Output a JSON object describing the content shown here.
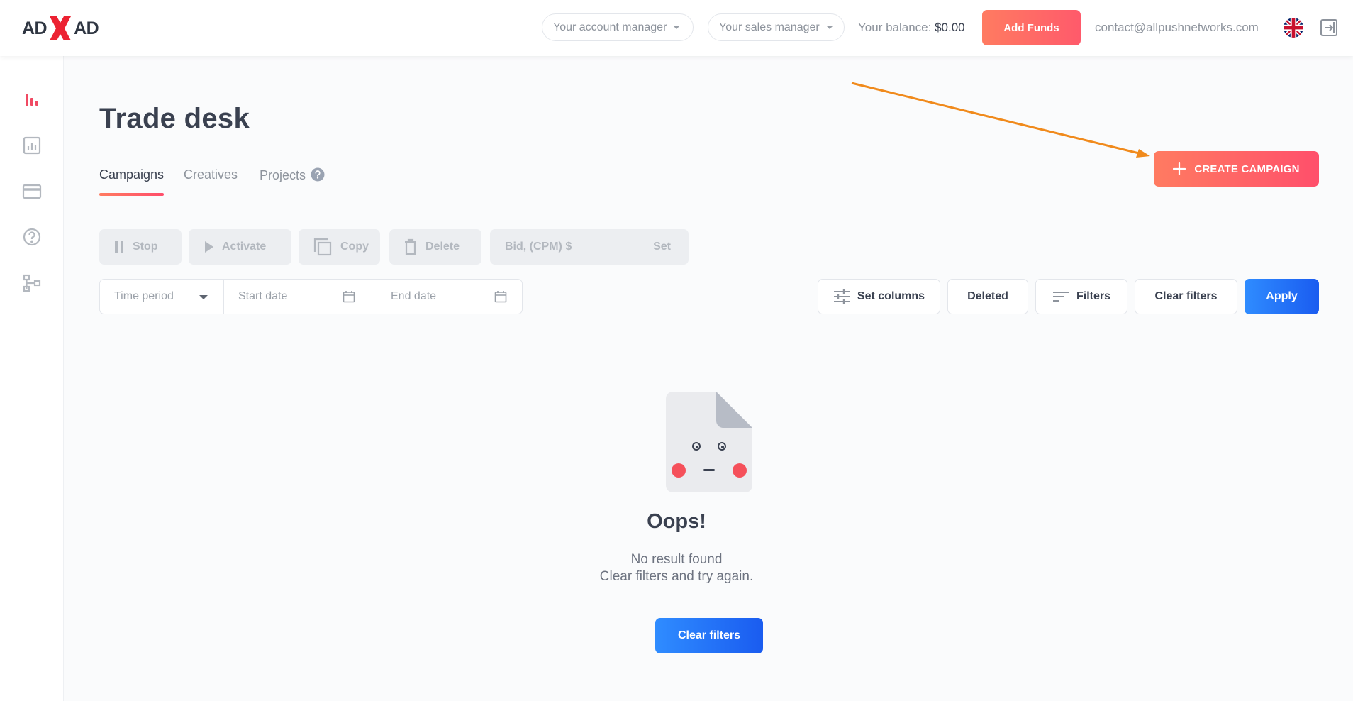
{
  "logo": {
    "left": "AD",
    "right": "AD"
  },
  "header": {
    "account_manager": "Your account manager",
    "sales_manager": "Your sales manager",
    "balance_label": "Your balance:",
    "balance_amount": "$0.00",
    "add_funds": "Add Funds",
    "email": "contact@allpushnetworks.com",
    "language_flag": "uk-flag",
    "logout_icon": "logout-icon"
  },
  "sidebar": {
    "items": [
      {
        "icon": "bar-chart-icon",
        "active": true
      },
      {
        "icon": "statistics-icon",
        "active": false
      },
      {
        "icon": "credit-card-icon",
        "active": false
      },
      {
        "icon": "help-circle-icon",
        "active": false
      },
      {
        "icon": "sitemap-icon",
        "active": false
      }
    ]
  },
  "page": {
    "title": "Trade desk",
    "tabs": [
      {
        "label": "Campaigns",
        "active": true
      },
      {
        "label": "Creatives",
        "active": false
      },
      {
        "label": "Projects",
        "active": false
      }
    ],
    "create_campaign": "CREATE CAMPAIGN"
  },
  "actions": {
    "stop": "Stop",
    "activate": "Activate",
    "copy": "Copy",
    "delete": "Delete",
    "bid_placeholder": "Bid, (CPM) $",
    "bid_set": "Set"
  },
  "filters": {
    "time_period": "Time period",
    "start_date": "Start date",
    "end_date": "End date",
    "set_columns": "Set columns",
    "deleted": "Deleted",
    "filters": "Filters",
    "clear_filters": "Clear filters",
    "apply": "Apply"
  },
  "empty_state": {
    "title": "Oops!",
    "line1": "No result found",
    "line2": "Clear filters and try again.",
    "button": "Clear filters"
  },
  "colors": {
    "accent_gradient_start": "#ff7b61",
    "accent_gradient_end": "#ff4f6b",
    "primary_blue": "#1a5cf0",
    "annotation_arrow": "#f08a1c"
  }
}
